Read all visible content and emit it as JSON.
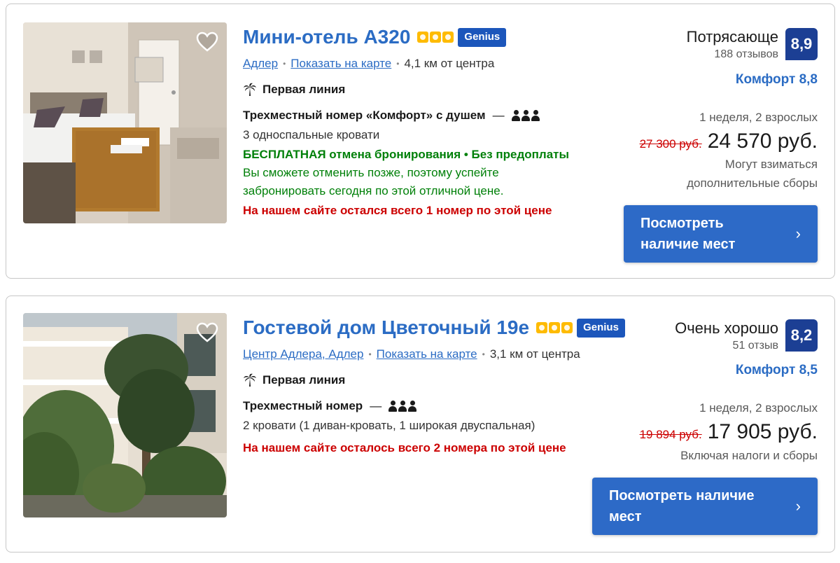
{
  "listings": [
    {
      "name": "Мини-отель А320",
      "stars": 3,
      "badge": "Genius",
      "location": "Адлер",
      "map_link": "Показать на карте",
      "distance": "4,1 км от центра",
      "feature": "Первая линия",
      "room_type": "Трехместный номер «Комфорт» с душем",
      "dash": "—",
      "beds": "3 односпальные кровати",
      "free_cancel": "БЕСПЛАТНАЯ отмена бронирования • Без предоплаты",
      "cancel_note": "Вы сможете отменить позже, поэтому успейте забронировать сегодня по этой отличной цене.",
      "scarcity": "На нашем сайте остался всего 1 номер по этой цене",
      "rating_word": "Потрясающе",
      "reviews": "188 отзывов",
      "score": "8,9",
      "comfort": "Комфорт 8,8",
      "stay": "1 неделя, 2 взрослых",
      "old_price": "27 300 руб.",
      "price": "24 570 руб.",
      "fee_note": "Могут взиматься дополнительные сборы",
      "cta": "Посмотреть наличие мест",
      "chevron": "›"
    },
    {
      "name": "Гостевой дом Цветочный 19е",
      "stars": 3,
      "badge": "Genius",
      "location": "Центр Адлера, Адлер",
      "map_link": "Показать на карте",
      "distance": "3,1 км от центра",
      "feature": "Первая линия",
      "room_type": "Трехместный номер",
      "dash": "—",
      "beds": "2 кровати (1 диван-кровать, 1 широкая двуспальная)",
      "scarcity": "На нашем сайте осталось всего 2 номера по этой цене",
      "rating_word": "Очень хорошо",
      "reviews": "51 отзыв",
      "score": "8,2",
      "comfort": "Комфорт 8,5",
      "stay": "1 неделя, 2 взрослых",
      "old_price": "19 894 руб.",
      "price": "17 905 руб.",
      "fee_note": "Включая налоги и сборы",
      "cta": "Посмотреть наличие мест",
      "chevron": "›"
    }
  ],
  "colors": {
    "link": "#2b6cc4",
    "score_bg": "#1c3f94",
    "genius_bg": "#1c56bb",
    "star": "#febb02",
    "green": "#008009",
    "red": "#cc0000",
    "cta_bg": "#2d6ac7"
  }
}
